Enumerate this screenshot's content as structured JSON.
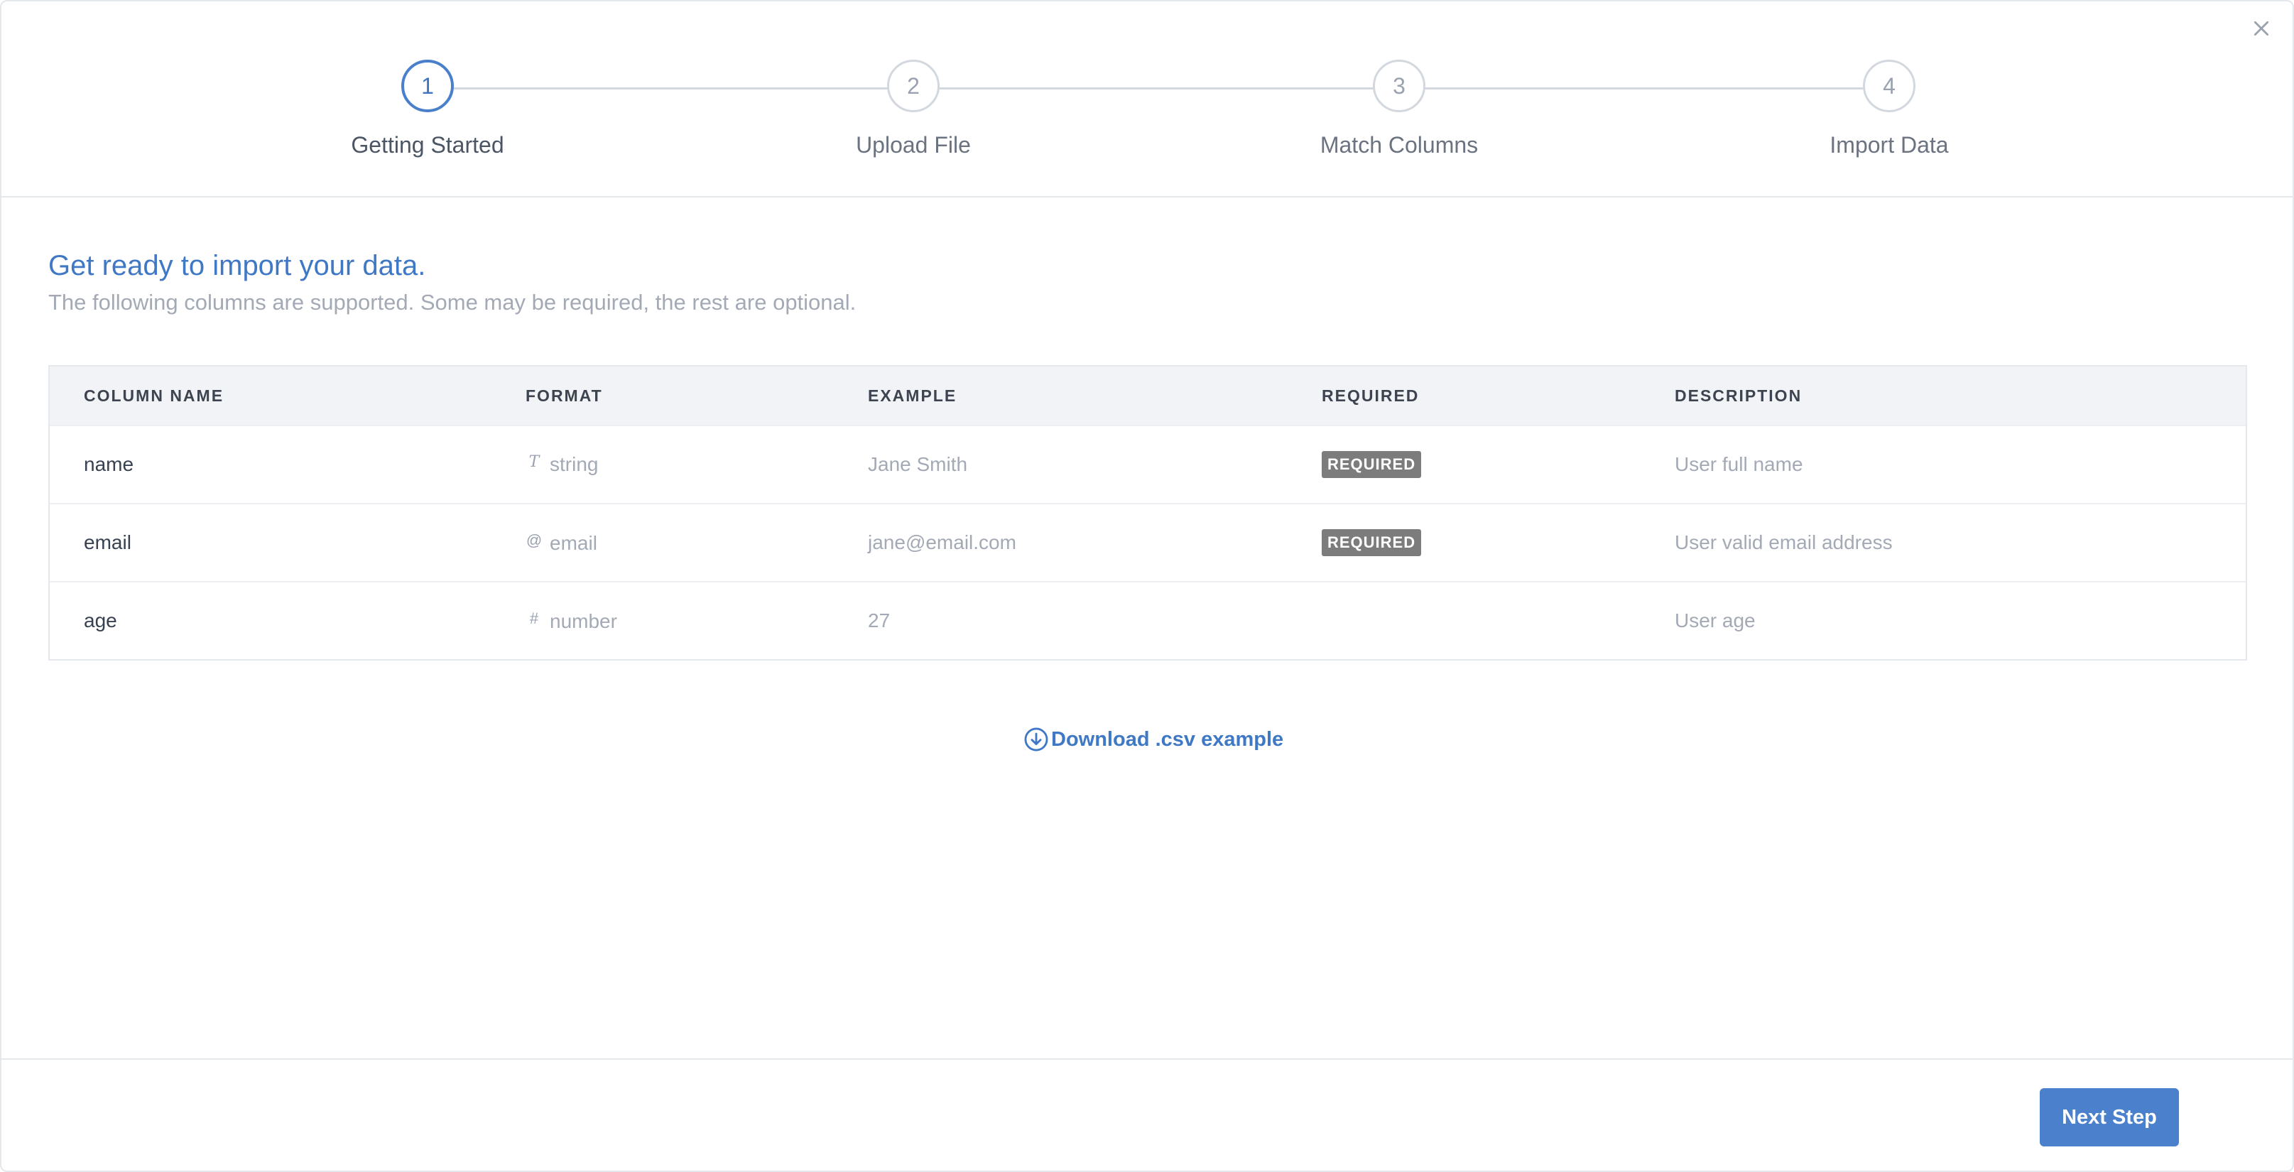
{
  "close_icon": "close-icon",
  "steps": [
    {
      "number": "1",
      "label": "Getting Started",
      "active": true
    },
    {
      "number": "2",
      "label": "Upload File",
      "active": false
    },
    {
      "number": "3",
      "label": "Match Columns",
      "active": false
    },
    {
      "number": "4",
      "label": "Import Data",
      "active": false
    }
  ],
  "intro": {
    "title": "Get ready to import your data.",
    "subtitle": "The following columns are supported. Some may be required, the rest are optional."
  },
  "table": {
    "headers": {
      "column_name": "COLUMN NAME",
      "format": "FORMAT",
      "example": "EXAMPLE",
      "required": "REQUIRED",
      "description": "DESCRIPTION"
    },
    "rows": [
      {
        "name": "name",
        "format_icon": "T",
        "format": "string",
        "example": "Jane Smith",
        "required": "REQUIRED",
        "description": "User full name"
      },
      {
        "name": "email",
        "format_icon": "@",
        "format": "email",
        "example": "jane@email.com",
        "required": "REQUIRED",
        "description": "User valid email address"
      },
      {
        "name": "age",
        "format_icon": "#",
        "format": "number",
        "example": "27",
        "required": "",
        "description": "User age"
      }
    ]
  },
  "download": {
    "label": "Download .csv example",
    "icon": "download-circle-icon"
  },
  "footer": {
    "next_label": "Next Step"
  },
  "colors": {
    "accent": "#4a80cc",
    "badge": "#7c7c7c"
  }
}
